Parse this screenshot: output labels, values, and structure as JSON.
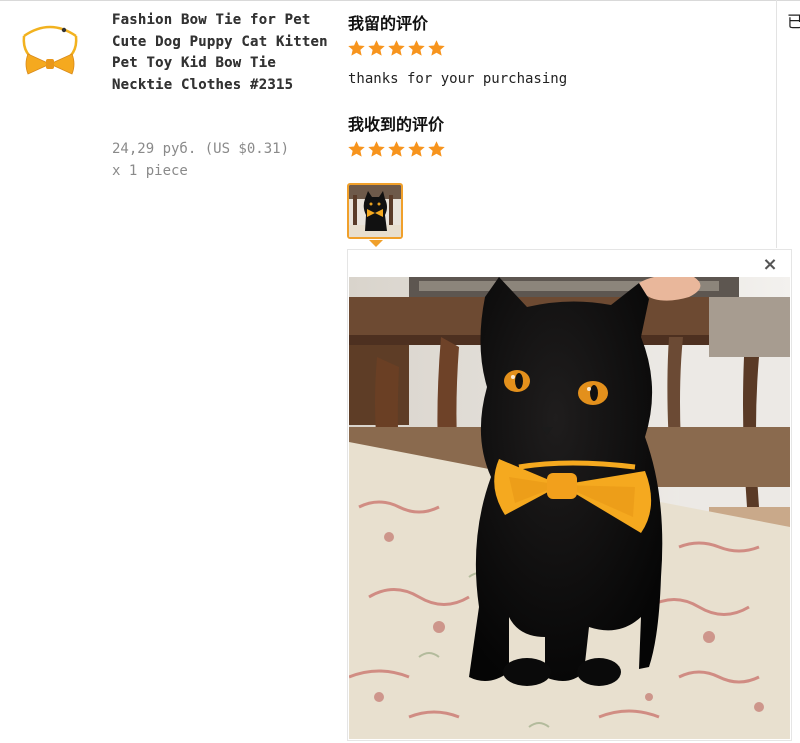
{
  "product": {
    "title": "Fashion Bow Tie for Pet Cute Dog Puppy Cat Kitten Pet Toy Kid Bow Tie Necktie Clothes #2315",
    "price": "24,29 руб. (US $0.31)",
    "quantity": "x 1 piece"
  },
  "my_review": {
    "heading": "我留的评价",
    "rating": 5,
    "comment": "thanks for your purchasing"
  },
  "received_review": {
    "heading": "我收到的评价",
    "rating": 5
  },
  "right_edge_char": "已",
  "viewer": {
    "close_label": "×"
  },
  "colors": {
    "star": "#f7941d",
    "accent": "#f0a02b",
    "bow": "#f5a91f"
  },
  "icons": {
    "star": "star-icon",
    "close": "close-icon"
  }
}
